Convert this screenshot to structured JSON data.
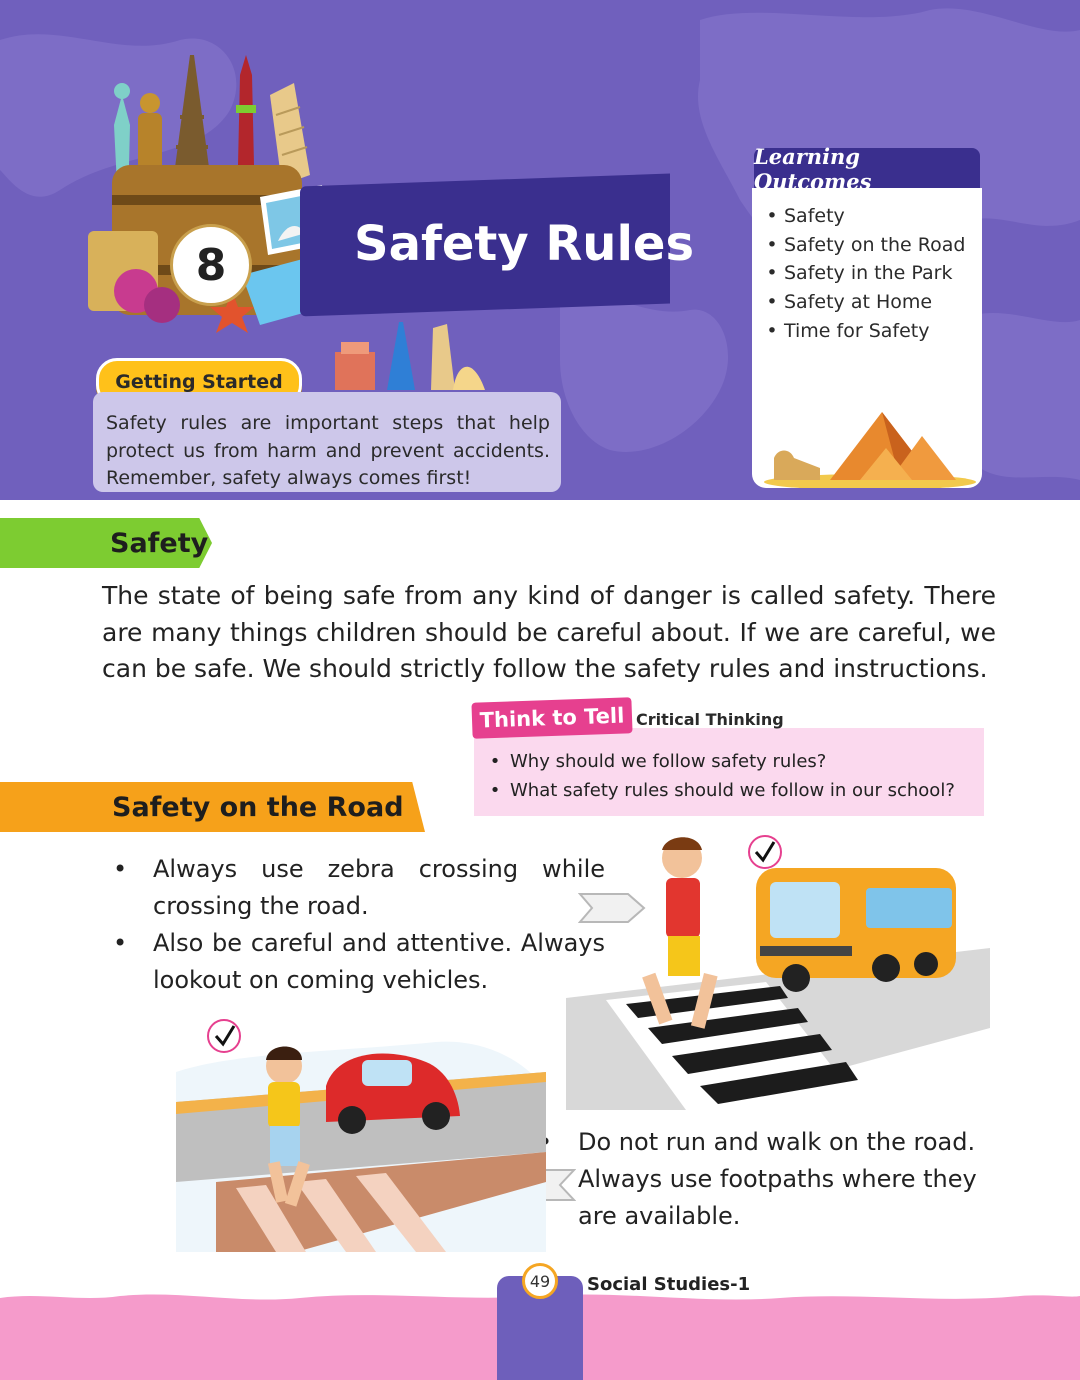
{
  "header": {
    "chapter_number": "8",
    "title": "Safety Rules",
    "getting_started": {
      "label": "Getting Started",
      "text": "Safety rules are important steps that help protect us from harm and prevent accidents. Remember, safety always comes first!"
    },
    "learning_outcomes": {
      "heading": "Learning Outcomes",
      "items": [
        "Safety",
        "Safety on the Road",
        "Safety in the Park",
        "Safety at Home",
        "Time for Safety"
      ]
    }
  },
  "section_safety": {
    "heading": "Safety",
    "paragraph": "The state of being safe from any kind of danger is called safety. There are many things children should be careful about. If we are careful, we can be safe. We should strictly follow the safety rules and instructions."
  },
  "think_to_tell": {
    "label": "Think to Tell",
    "subtitle": "Critical Thinking",
    "questions": [
      "Why should we follow safety rules?",
      "What safety rules should we follow in our school?"
    ]
  },
  "section_road": {
    "heading": "Safety on the Road",
    "rules": [
      "Always use zebra crossing while crossing the road.",
      "Also be careful and attentive. Always lookout on coming vehicles.",
      "Do not run and walk on the road. Always use footpaths where they are available."
    ]
  },
  "footer": {
    "page_number": "49",
    "book_title": "Social Studies-1"
  },
  "colors": {
    "header_bg": "#7060bd",
    "title_banner": "#3a2f8e",
    "safety_tab": "#7dcc31",
    "road_tab": "#f6a11a",
    "think_pill": "#e6408f",
    "think_box": "#fbd9ee",
    "footer_pink": "#f59bcb"
  }
}
